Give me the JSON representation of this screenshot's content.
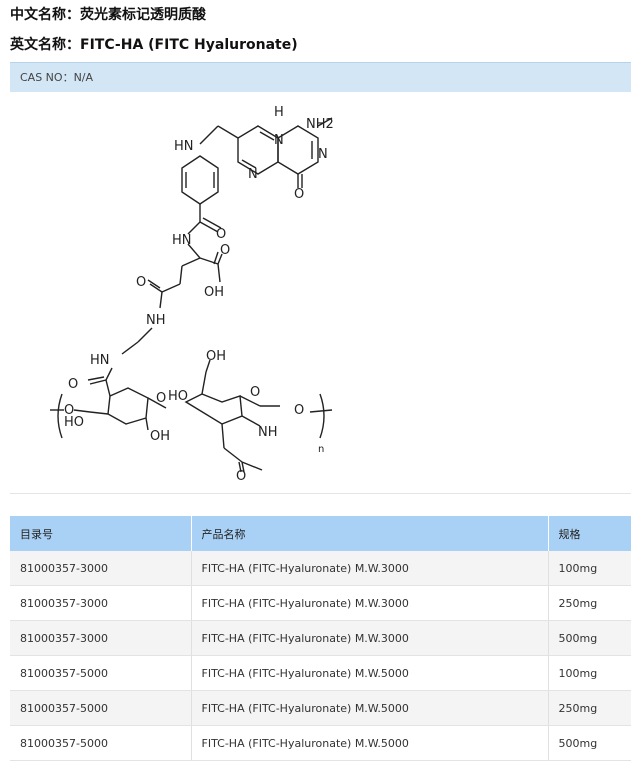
{
  "header": {
    "cn_label": "中文名称：",
    "cn_value": "荧光素标记透明质酸",
    "en_label": "英文名称：",
    "en_value": "FITC-HA (FITC Hyaluronate)"
  },
  "cas": {
    "label": "CAS NO：",
    "value": "N/A"
  },
  "structure_labels": {
    "h": "H",
    "nh2": "NH2",
    "n": "N",
    "o": "O",
    "hn": "HN",
    "oh": "OH",
    "nh": "NH",
    "ho": "HO",
    "repeat": "n"
  },
  "table": {
    "headers": [
      "目录号",
      "产品名称",
      "规格"
    ],
    "rows": [
      [
        "81000357-3000",
        "FITC-HA (FITC-Hyaluronate) M.W.3000",
        "100mg"
      ],
      [
        "81000357-3000",
        "FITC-HA (FITC-Hyaluronate) M.W.3000",
        "250mg"
      ],
      [
        "81000357-3000",
        "FITC-HA (FITC-Hyaluronate) M.W.3000",
        "500mg"
      ],
      [
        "81000357-5000",
        "FITC-HA (FITC-Hyaluronate) M.W.5000",
        "100mg"
      ],
      [
        "81000357-5000",
        "FITC-HA (FITC-Hyaluronate) M.W.5000",
        "250mg"
      ],
      [
        "81000357-5000",
        "FITC-HA (FITC-Hyaluronate) M.W.5000",
        "500mg"
      ]
    ]
  }
}
